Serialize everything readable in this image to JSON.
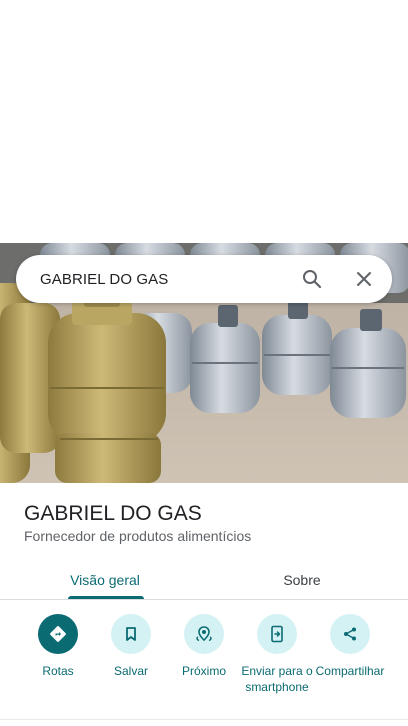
{
  "search": {
    "query": "GABRIEL DO GAS"
  },
  "place": {
    "name": "GABRIEL DO GAS",
    "category": "Fornecedor de produtos alimentícios"
  },
  "tabs": [
    {
      "label": "Visão geral",
      "selected": true
    },
    {
      "label": "Sobre",
      "selected": false
    }
  ],
  "actions": [
    {
      "label": "Rotas",
      "icon": "directions-icon"
    },
    {
      "label": "Salvar",
      "icon": "bookmark-icon"
    },
    {
      "label": "Próximo",
      "icon": "nearby-icon"
    },
    {
      "label": "Enviar para o smartphone",
      "icon": "send-to-phone-icon"
    },
    {
      "label": "Compartilhar",
      "icon": "share-icon"
    }
  ],
  "colors": {
    "accent": "#0b6b73",
    "action_bg": "#d4f2f4"
  }
}
